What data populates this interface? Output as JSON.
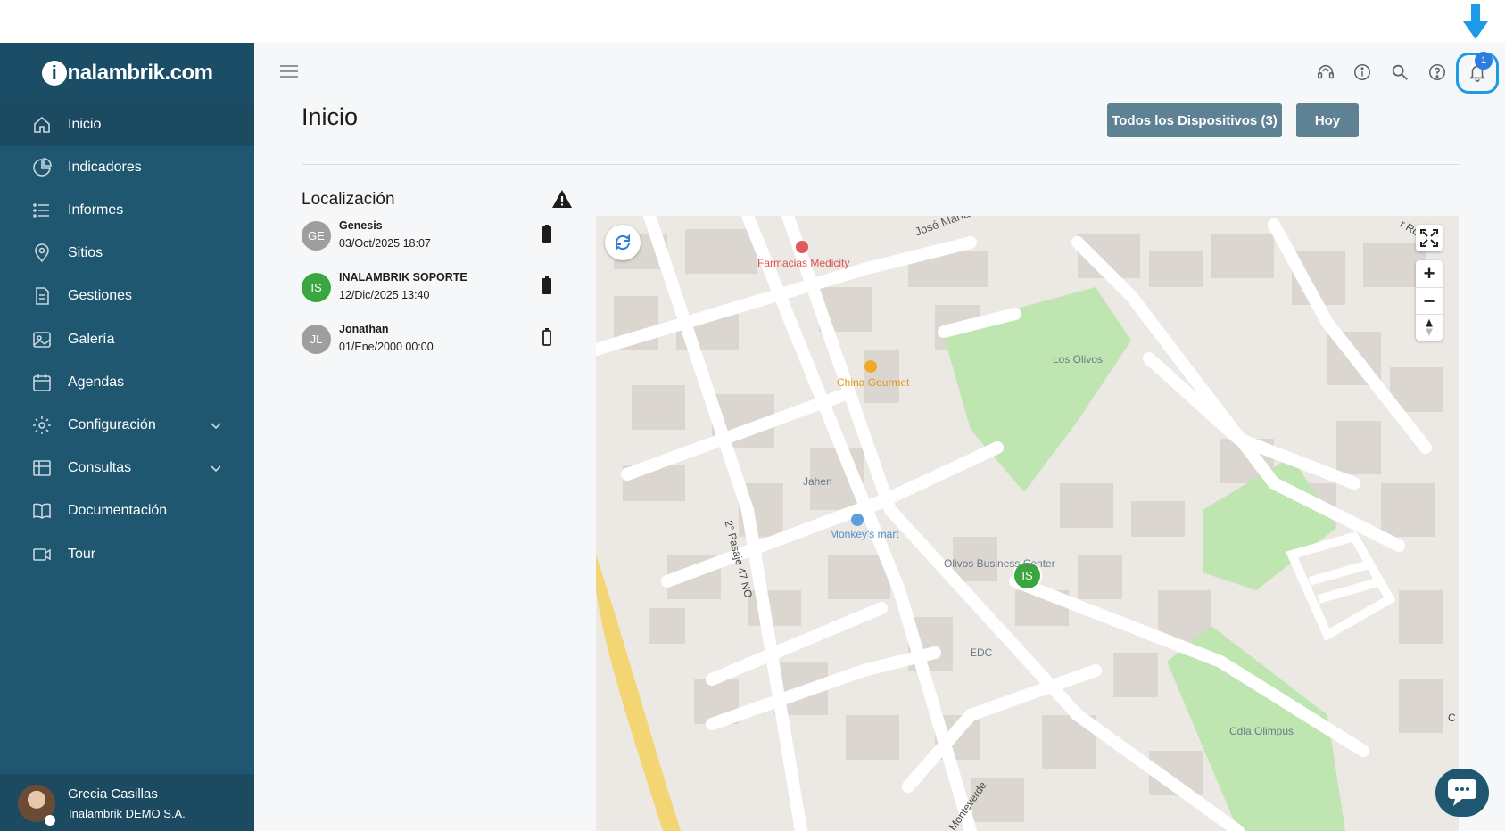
{
  "brand": {
    "logo_text": "inalambrik.com",
    "logo_letter": "i",
    "logo_rest": "nalambrik.com"
  },
  "sidebar": {
    "items": [
      {
        "label": "Inicio",
        "icon": "home-icon",
        "active": true
      },
      {
        "label": "Indicadores",
        "icon": "pie-chart-icon"
      },
      {
        "label": "Informes",
        "icon": "list-icon"
      },
      {
        "label": "Sitios",
        "icon": "location-pin-icon"
      },
      {
        "label": "Gestiones",
        "icon": "document-icon"
      },
      {
        "label": "Galería",
        "icon": "image-icon"
      },
      {
        "label": "Agendas",
        "icon": "calendar-icon"
      },
      {
        "label": "Configuración",
        "icon": "gear-icon",
        "expandable": true
      },
      {
        "label": "Consultas",
        "icon": "table-icon",
        "expandable": true
      },
      {
        "label": "Documentación",
        "icon": "book-icon"
      },
      {
        "label": "Tour",
        "icon": "video-icon"
      }
    ]
  },
  "user": {
    "name": "Grecia Casillas",
    "company": "Inalambrik DEMO S.A."
  },
  "topbar": {
    "icons": [
      "headset-icon",
      "info-icon",
      "search-icon",
      "help-icon",
      "bell-icon"
    ],
    "notification_count": "1"
  },
  "page": {
    "title": "Inicio",
    "devices_button": "Todos los Dispositivos (3)",
    "today_button": "Hoy"
  },
  "location": {
    "title": "Localización",
    "devices": [
      {
        "initials": "GE",
        "name": "Genesis",
        "date": "03/Oct/2025 18:07",
        "color": "#9e9e9e",
        "battery": "full"
      },
      {
        "initials": "IS",
        "name": "INALAMBRIK SOPORTE",
        "date": "12/Dic/2025 13:40",
        "color": "#3aa63f",
        "battery": "full"
      },
      {
        "initials": "JL",
        "name": "Jonathan",
        "date": "01/Ene/2000 00:00",
        "color": "#9e9e9e",
        "battery": "empty"
      }
    ]
  },
  "map": {
    "labels": {
      "pharmacy": "Farmacias Medicity",
      "restaurant": "China Gourmet",
      "park": "Los Olivos",
      "place_jahen": "Jahen",
      "shop": "Monkey's mart",
      "business": "Olivos Business Center",
      "edc": "EDC",
      "olimpus": "Cdla.Olimpus",
      "street_jose": "José María",
      "street_pasaje": "2° Pasaje 47 NO",
      "street_monteverde": "Monteverde",
      "street_corner": "r Ro M",
      "edge_c": "C"
    },
    "marker_initials": "IS",
    "zoom_in": "+",
    "zoom_out": "−"
  }
}
